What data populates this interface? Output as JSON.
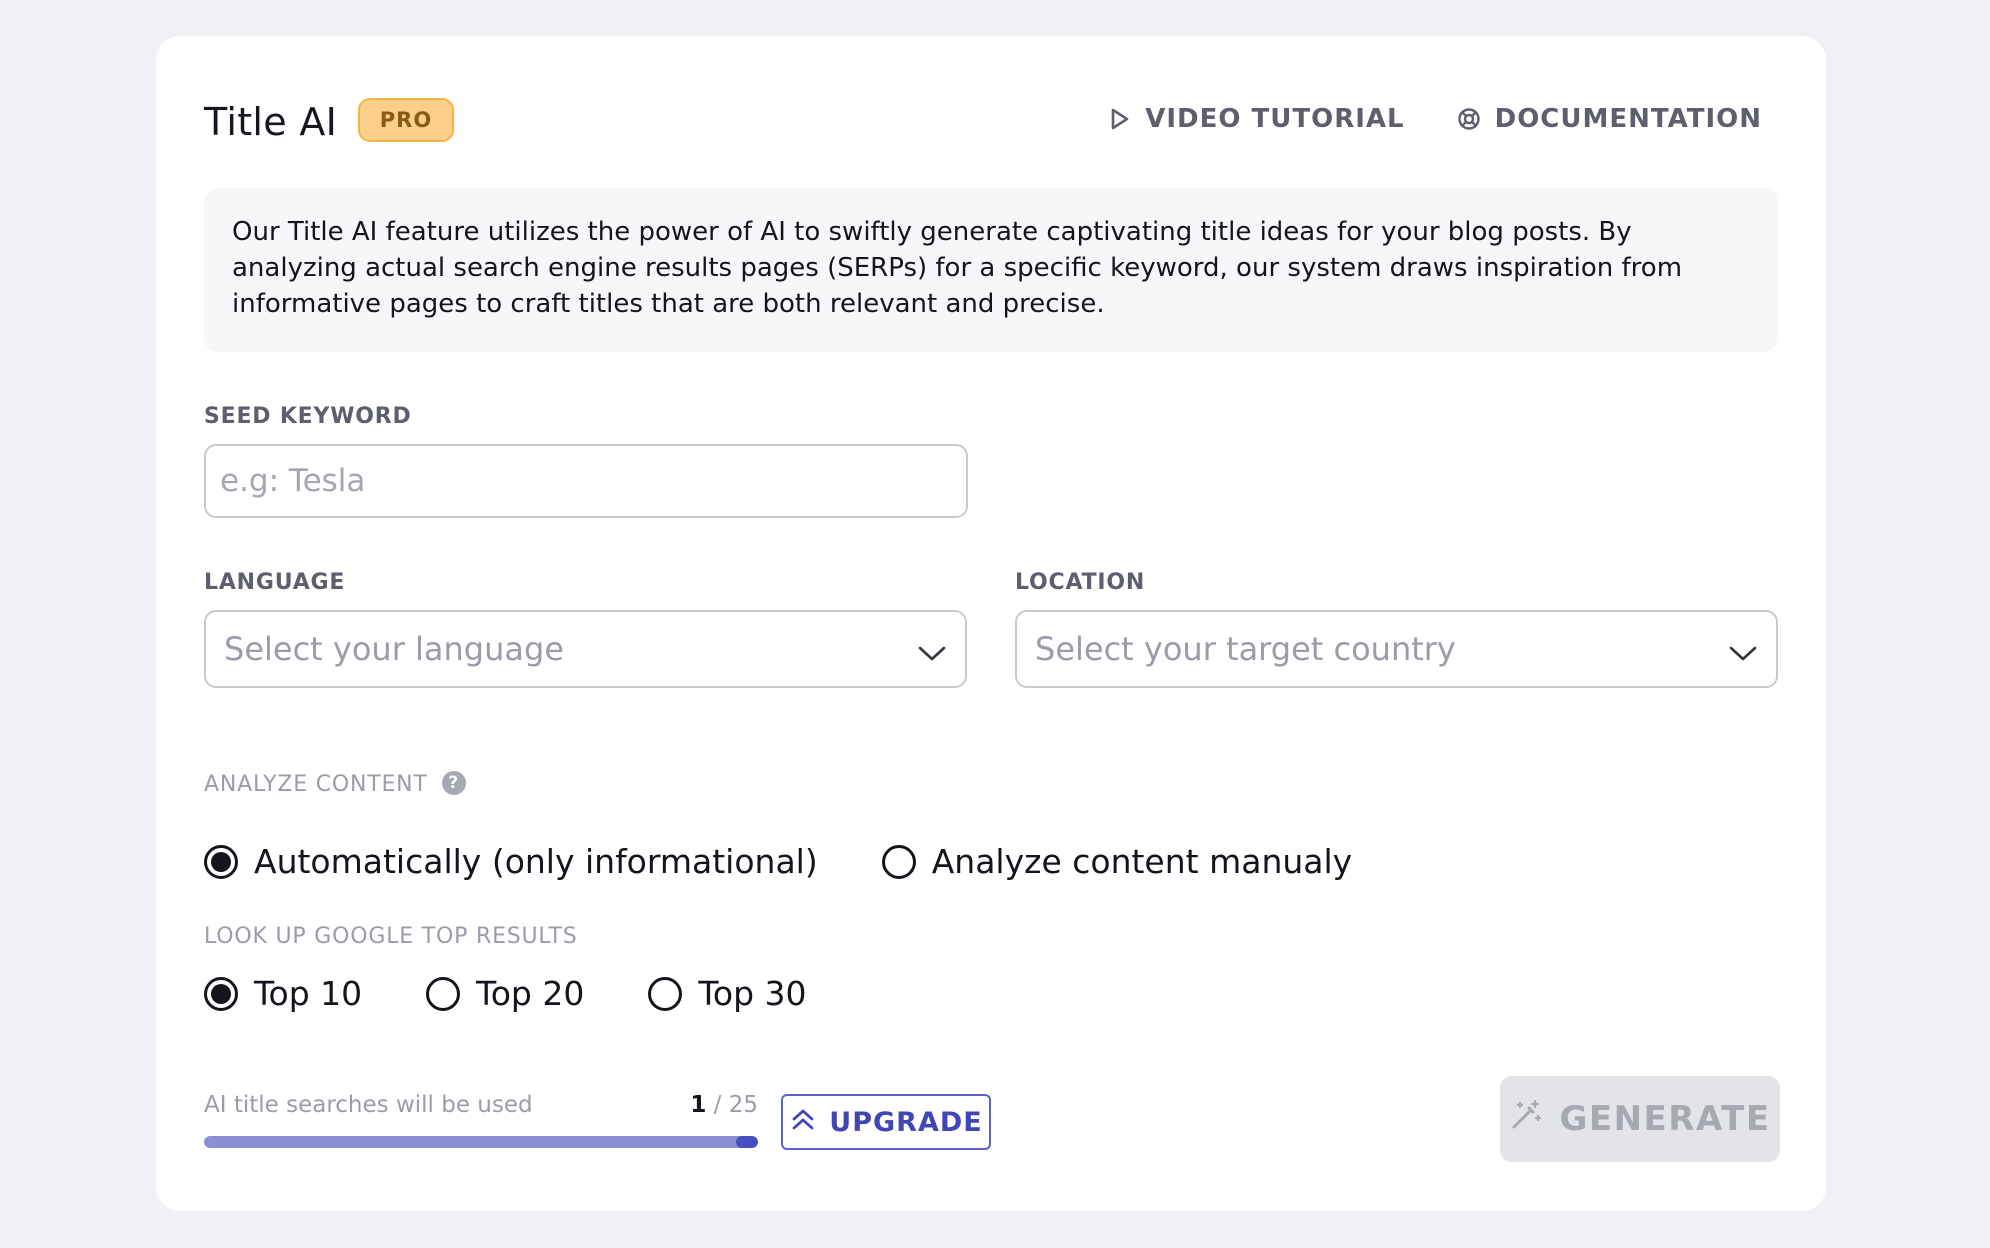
{
  "header": {
    "title": "Title AI",
    "badge": "PRO",
    "video_tutorial": "VIDEO TUTORIAL",
    "documentation": "DOCUMENTATION"
  },
  "description": "Our Title AI feature utilizes the power of AI to swiftly generate captivating title ideas for your blog posts. By analyzing actual search engine results pages (SERPs) for a specific keyword, our system draws inspiration from informative pages to craft titles that are both relevant and precise.",
  "seed_keyword": {
    "label": "SEED KEYWORD",
    "value": "",
    "placeholder": "e.g: Tesla"
  },
  "language": {
    "label": "LANGUAGE",
    "placeholder": "Select your language"
  },
  "location": {
    "label": "LOCATION",
    "placeholder": "Select your target country"
  },
  "analyze_content": {
    "label": "ANALYZE CONTENT",
    "help_icon": "?",
    "options": [
      {
        "label": "Automatically (only informational)",
        "selected": true
      },
      {
        "label": "Analyze content manualy",
        "selected": false
      }
    ]
  },
  "top_results": {
    "label": "LOOK UP GOOGLE TOP RESULTS",
    "options": [
      {
        "label": "Top 10",
        "selected": true
      },
      {
        "label": "Top 20",
        "selected": false
      },
      {
        "label": "Top 30",
        "selected": false
      }
    ]
  },
  "usage": {
    "label": "AI title searches will be used",
    "used": "1",
    "separator": " / ",
    "total": "25",
    "progress_fraction": 1.0
  },
  "buttons": {
    "upgrade": "UPGRADE",
    "generate": "GENERATE"
  },
  "colors": {
    "accent": "#4046b6",
    "badge_bg": "#fbd08a",
    "progress_fill": "#8b8fd6",
    "disabled_bg": "#e3e4e8"
  },
  "icons": {
    "video_tutorial": "play-icon",
    "documentation": "lifebuoy-icon",
    "select": "chevron-down-icon",
    "upgrade": "double-chevron-up-icon",
    "generate": "magic-wand-icon"
  }
}
